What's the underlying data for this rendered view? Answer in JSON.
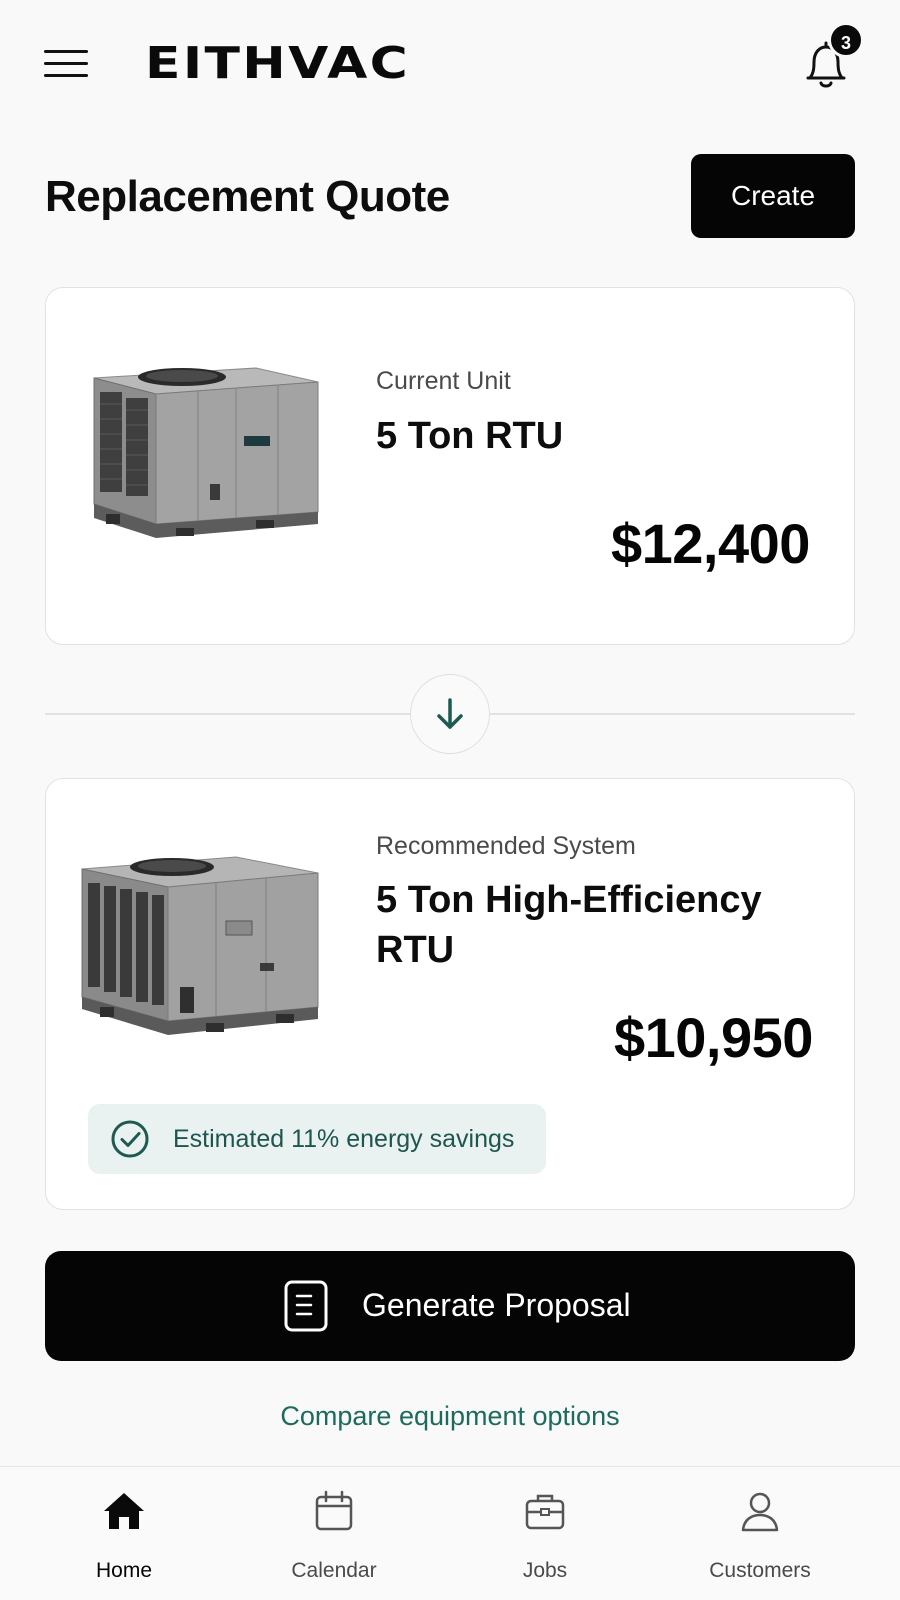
{
  "header": {
    "logo": "EITHVAC",
    "notification_count": "3"
  },
  "page": {
    "title": "Replacement Quote",
    "create_label": "Create"
  },
  "current_unit": {
    "label": "Current Unit",
    "name": "5 Ton RTU",
    "price": "$12,400",
    "image": "rooftop-unit-image"
  },
  "recommended_system": {
    "label": "Recommended System",
    "name": "5 Ton High-Efficiency RTU",
    "price": "$10,950",
    "image": "rooftop-unit-image",
    "savings_text": "Estimated 11% energy savings"
  },
  "actions": {
    "generate_label": "Generate Proposal",
    "compare_label": "Compare equipment options"
  },
  "nav": {
    "items": [
      {
        "label": "Home",
        "icon": "home-icon",
        "active": true
      },
      {
        "label": "Calendar",
        "icon": "calendar-icon",
        "active": false
      },
      {
        "label": "Jobs",
        "icon": "briefcase-icon",
        "active": false
      },
      {
        "label": "Customers",
        "icon": "user-icon",
        "active": false
      }
    ]
  },
  "colors": {
    "accent": "#1d6a5f",
    "savings_bg": "#e9f2f0",
    "primary_button": "#050505"
  }
}
